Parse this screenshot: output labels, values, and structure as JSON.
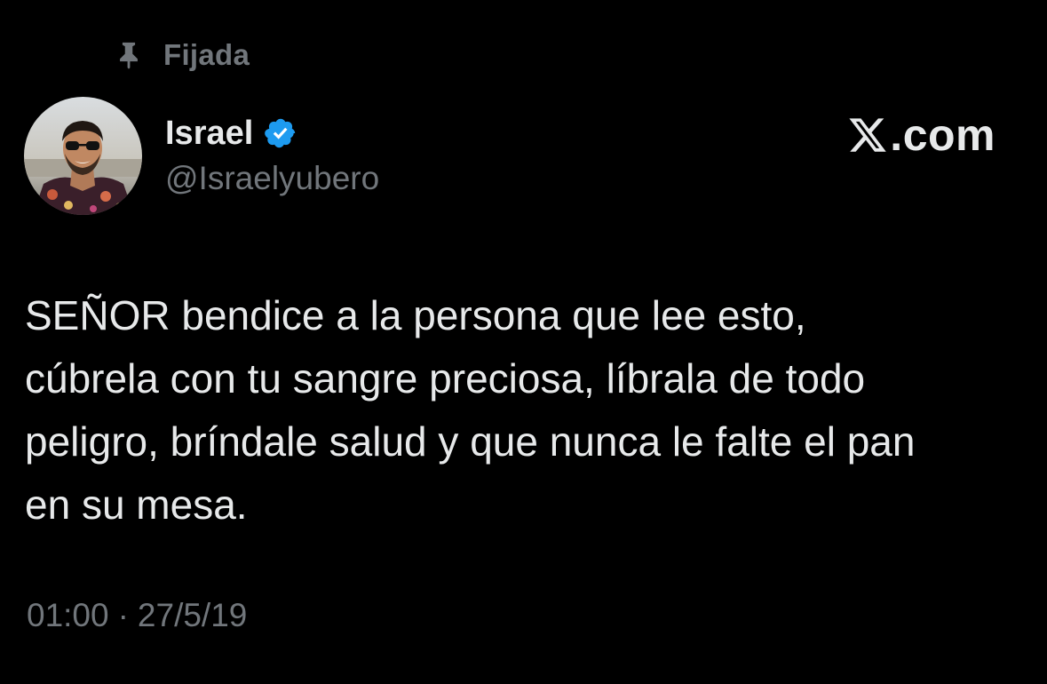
{
  "pinned": {
    "label": "Fijada",
    "icon": "pin-icon"
  },
  "author": {
    "display_name": "Israel",
    "handle": "@Israelyubero",
    "verified": true,
    "verified_icon": "verified-badge-icon",
    "verified_color": "#1d9bf0",
    "avatar_icon": "avatar-photo"
  },
  "brand": {
    "icon": "x-logo-icon",
    "text": ".com"
  },
  "tweet": {
    "text": "SEÑOR bendice a la persona que lee esto,\ncúbrela con tu sangre preciosa, líbrala de todo\npeligro, bríndale salud y que nunca le falte el pan\nen su mesa."
  },
  "meta": {
    "time": "01:00",
    "separator": "·",
    "date": "27/5/19"
  },
  "colors": {
    "background": "#000000",
    "primary_text": "#e7e9ea",
    "secondary_text": "#71767b",
    "accent": "#1d9bf0"
  }
}
